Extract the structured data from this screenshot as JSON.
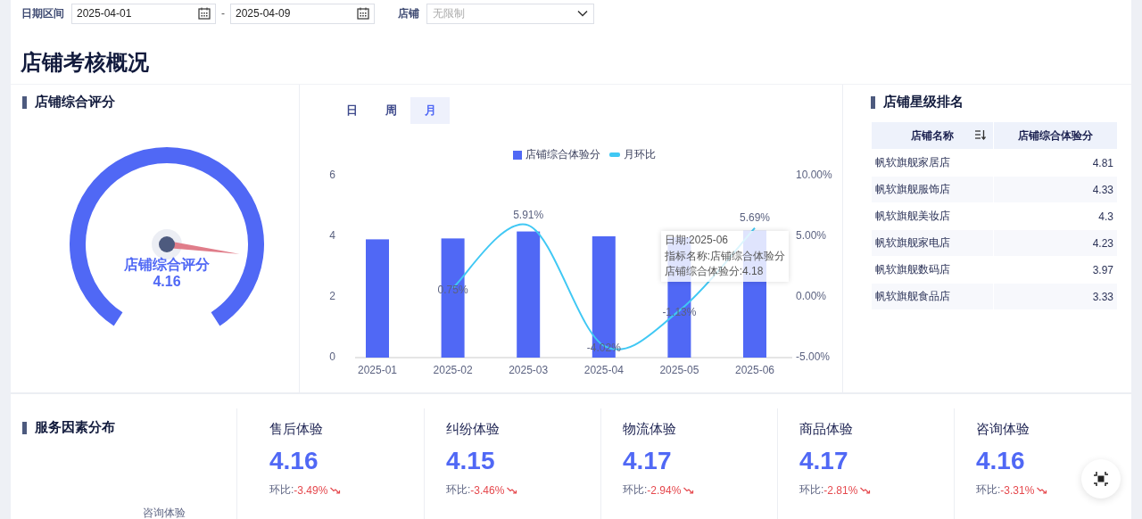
{
  "filters": {
    "date_range": {
      "label": "日期区间",
      "start": "2025-04-01",
      "separator": "-",
      "end": "2025-04-09"
    },
    "store": {
      "label": "店铺",
      "placeholder": "无限制"
    }
  },
  "page_title": "店铺考核概况",
  "score_panel": {
    "title": "店铺综合评分",
    "gauge": {
      "label": "店铺综合评分",
      "value": "4.16",
      "level": 0.832
    }
  },
  "trend_panel": {
    "tabs": [
      {
        "label": "日",
        "selected": false
      },
      {
        "label": "周",
        "selected": false
      },
      {
        "label": "月",
        "selected": true
      }
    ],
    "chart_data": {
      "type": "bar",
      "categories": [
        "2025-01",
        "2025-02",
        "2025-03",
        "2025-04",
        "2025-05",
        "2025-06"
      ],
      "ylim": [
        0,
        6
      ],
      "yticks": [
        0,
        2,
        4,
        6
      ],
      "y2lim": [
        -5,
        10
      ],
      "y2ticks": [
        {
          "value": -5,
          "label": "-5.00%"
        },
        {
          "value": 0,
          "label": "0.00%"
        },
        {
          "value": 5,
          "label": "5.00%"
        },
        {
          "value": 10,
          "label": "10.00%"
        }
      ],
      "series": [
        {
          "name": "店铺综合体验分",
          "color": "#5068f5",
          "type": "bar",
          "values": [
            3.9,
            3.93,
            4.16,
            4.0,
            3.97,
            4.18
          ]
        },
        {
          "name": "月环比",
          "color": "#40c8f4",
          "type": "line",
          "axis": "y2",
          "values": [
            null,
            0.75,
            5.91,
            -4.02,
            -1.13,
            5.69
          ],
          "value_labels": [
            null,
            "0.75%",
            "5.91%",
            "-4.02%",
            "-1.13%",
            "5.69%"
          ]
        }
      ]
    },
    "tooltip": {
      "lines": [
        "日期:2025-06",
        "指标名称:店铺综合体验分",
        "店铺综合体验分:4.18"
      ]
    }
  },
  "ranking_panel": {
    "title": "店铺星级排名",
    "columns": [
      {
        "label": "店铺名称",
        "sortable": true
      },
      {
        "label": "店铺综合体验分",
        "sortable": false
      }
    ],
    "rows": [
      {
        "store": "帆软旗舰家居店",
        "score": "4.81"
      },
      {
        "store": "帆软旗舰服饰店",
        "score": "4.33"
      },
      {
        "store": "帆软旗舰美妆店",
        "score": "4.3"
      },
      {
        "store": "帆软旗舰家电店",
        "score": "4.23"
      },
      {
        "store": "帆软旗舰数码店",
        "score": "3.97"
      },
      {
        "store": "帆软旗舰食品店",
        "score": "3.33"
      }
    ]
  },
  "service_panel": {
    "title": "服务因素分布",
    "pie_label": "咨询体验"
  },
  "metrics": [
    {
      "title": "售后体验",
      "value": "4.16",
      "change_label": "环比:",
      "change": "-3.49%",
      "declining": true
    },
    {
      "title": "纠纷体验",
      "value": "4.15",
      "change_label": "环比:",
      "change": "-3.46%",
      "declining": true
    },
    {
      "title": "物流体验",
      "value": "4.17",
      "change_label": "环比:",
      "change": "-2.94%",
      "declining": true
    },
    {
      "title": "商品体验",
      "value": "4.17",
      "change_label": "环比:",
      "change": "-2.81%",
      "declining": true
    },
    {
      "title": "咨询体验",
      "value": "4.16",
      "change_label": "环比:",
      "change": "-3.31%",
      "declining": true
    }
  ]
}
